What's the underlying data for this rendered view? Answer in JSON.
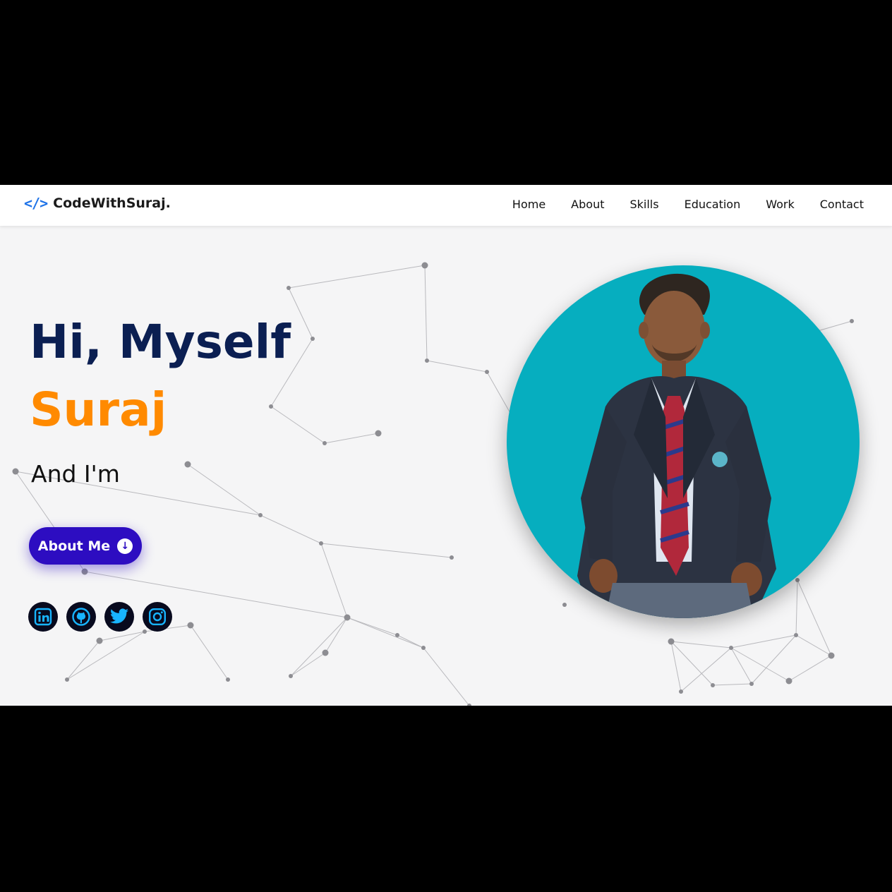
{
  "brand": {
    "icon": "</>",
    "name": "CodeWithSuraj."
  },
  "nav": {
    "items": [
      {
        "label": "Home"
      },
      {
        "label": "About"
      },
      {
        "label": "Skills"
      },
      {
        "label": "Education"
      },
      {
        "label": "Work"
      },
      {
        "label": "Contact"
      }
    ]
  },
  "hero": {
    "greeting": "Hi, Myself",
    "name": "Suraj",
    "role_prefix": "And I'm",
    "button_label": "About Me"
  },
  "socials": [
    {
      "icon": "linkedin-icon"
    },
    {
      "icon": "github-icon"
    },
    {
      "icon": "twitter-icon"
    },
    {
      "icon": "instagram-icon"
    }
  ],
  "colors": {
    "accent": "#2d0dc1",
    "name": "#ff8a00",
    "heading": "#0b1f52",
    "avatar_bg": "#06aebf",
    "logo": "#1e73e8"
  }
}
